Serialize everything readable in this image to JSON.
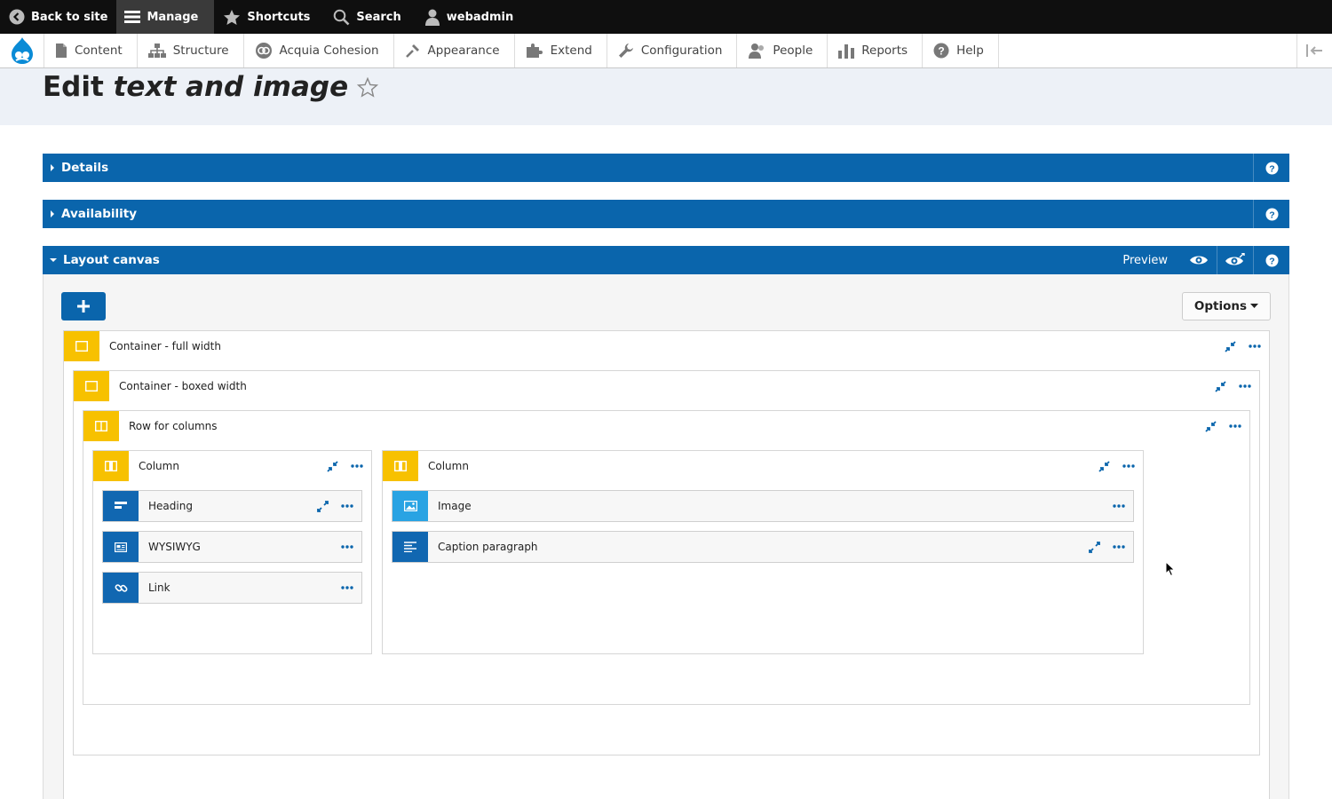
{
  "toolbar": {
    "back_to_site": "Back to site",
    "manage": "Manage",
    "shortcuts": "Shortcuts",
    "search": "Search",
    "user": "webadmin"
  },
  "tray": {
    "items": [
      "Content",
      "Structure",
      "Acquia Cohesion",
      "Appearance",
      "Extend",
      "Configuration",
      "People",
      "Reports",
      "Help"
    ]
  },
  "page": {
    "title_prefix": "Edit ",
    "title_italic": "text and image"
  },
  "sections": {
    "details": "Details",
    "availability": "Availability",
    "layout_canvas": "Layout canvas",
    "preview": "Preview"
  },
  "canvas": {
    "options": "Options",
    "container_full": "Container - full width",
    "container_boxed": "Container - boxed width",
    "row": "Row for columns",
    "column_left": "Column",
    "column_right": "Column",
    "heading": "Heading",
    "wysiwyg": "WYSIWYG",
    "link": "Link",
    "image": "Image",
    "caption": "Caption paragraph"
  },
  "colors": {
    "accent_blue": "#0a65ac",
    "element_yellow": "#f7c100",
    "toolbar_black": "#0f0f0f"
  }
}
